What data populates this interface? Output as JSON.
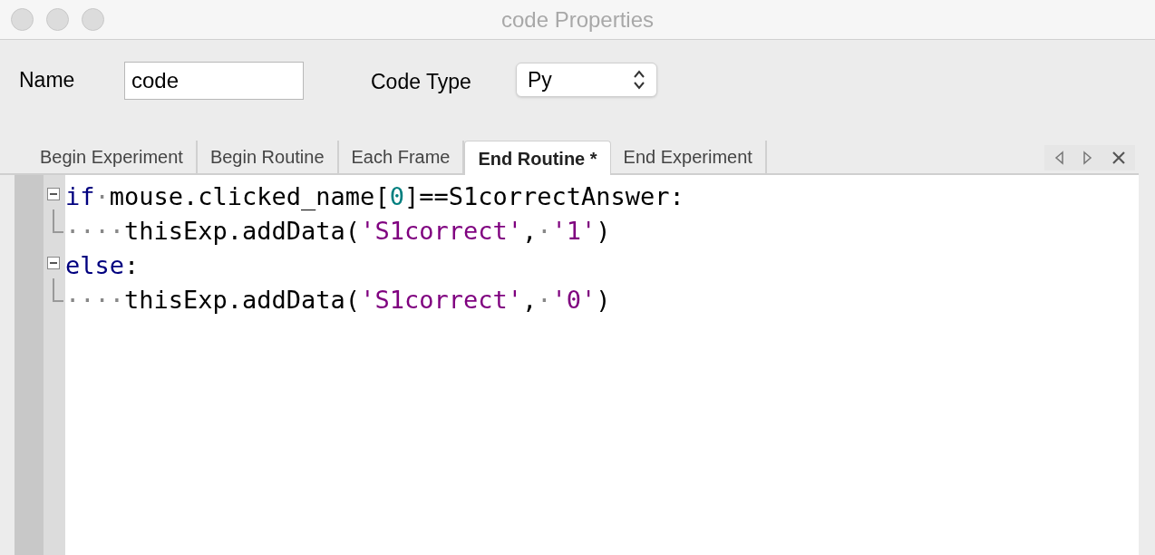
{
  "window": {
    "title": "code Properties"
  },
  "form": {
    "name_label": "Name",
    "name_value": "code",
    "type_label": "Code Type",
    "type_value": "Py"
  },
  "tabs": [
    {
      "label": "Begin Experiment",
      "selected": false
    },
    {
      "label": "Begin Routine",
      "selected": false
    },
    {
      "label": "Each Frame",
      "selected": false
    },
    {
      "label": "End Routine *",
      "selected": true
    },
    {
      "label": "End Experiment",
      "selected": false
    }
  ],
  "editor": {
    "lines": [
      {
        "kind": "fold-start",
        "tokens": [
          {
            "kind": "keyword",
            "text": "if"
          },
          {
            "kind": "space",
            "text": "·"
          },
          {
            "kind": "plain",
            "text": "mouse.clicked_name["
          },
          {
            "kind": "number",
            "text": "0"
          },
          {
            "kind": "plain",
            "text": "]==S1correctAnswer:"
          }
        ]
      },
      {
        "kind": "fold-end",
        "tokens": [
          {
            "kind": "space",
            "text": "····"
          },
          {
            "kind": "plain",
            "text": "thisExp.addData("
          },
          {
            "kind": "string",
            "text": "'S1correct'"
          },
          {
            "kind": "plain",
            "text": ","
          },
          {
            "kind": "space",
            "text": "·"
          },
          {
            "kind": "string",
            "text": "'1'"
          },
          {
            "kind": "plain",
            "text": ")"
          }
        ]
      },
      {
        "kind": "fold-start",
        "tokens": [
          {
            "kind": "keyword",
            "text": "else"
          },
          {
            "kind": "plain",
            "text": ":"
          }
        ]
      },
      {
        "kind": "fold-end",
        "tokens": [
          {
            "kind": "space",
            "text": "····"
          },
          {
            "kind": "plain",
            "text": "thisExp.addData("
          },
          {
            "kind": "string",
            "text": "'S1correct'"
          },
          {
            "kind": "plain",
            "text": ","
          },
          {
            "kind": "space",
            "text": "·"
          },
          {
            "kind": "string",
            "text": "'0'"
          },
          {
            "kind": "plain",
            "text": ")"
          }
        ]
      }
    ]
  }
}
